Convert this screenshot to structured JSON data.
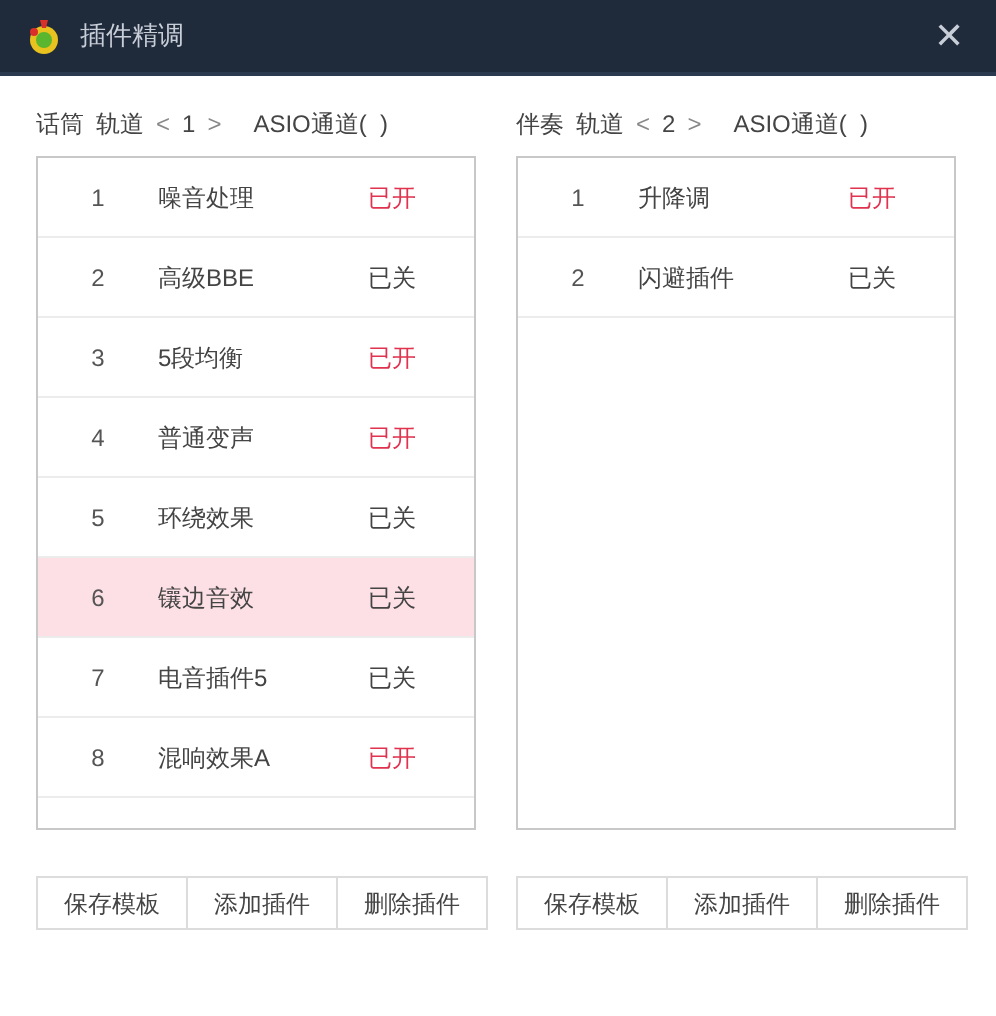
{
  "window": {
    "title": "插件精调",
    "close": "✕"
  },
  "panels": [
    {
      "source": "话筒",
      "track_label": "轨道",
      "track_prev": "<",
      "track": "1",
      "track_next": ">",
      "asio": "ASIO通道(  )",
      "plugins": [
        {
          "index": "1",
          "name": "噪音处理",
          "status": "已开",
          "on": true,
          "selected": false
        },
        {
          "index": "2",
          "name": "高级BBE",
          "status": "已关",
          "on": false,
          "selected": false
        },
        {
          "index": "3",
          "name": "5段均衡",
          "status": "已开",
          "on": true,
          "selected": false
        },
        {
          "index": "4",
          "name": "普通变声",
          "status": "已开",
          "on": true,
          "selected": false
        },
        {
          "index": "5",
          "name": "环绕效果",
          "status": "已关",
          "on": false,
          "selected": false
        },
        {
          "index": "6",
          "name": "镶边音效",
          "status": "已关",
          "on": false,
          "selected": true
        },
        {
          "index": "7",
          "name": "电音插件5",
          "status": "已关",
          "on": false,
          "selected": false
        },
        {
          "index": "8",
          "name": "混响效果A",
          "status": "已开",
          "on": true,
          "selected": false
        }
      ],
      "buttons": [
        "保存模板",
        "添加插件",
        "删除插件"
      ]
    },
    {
      "source": "伴奏",
      "track_label": "轨道",
      "track_prev": "<",
      "track": "2",
      "track_next": ">",
      "asio": "ASIO通道(  )",
      "plugins": [
        {
          "index": "1",
          "name": "升降调",
          "status": "已开",
          "on": true,
          "selected": false
        },
        {
          "index": "2",
          "name": "闪避插件",
          "status": "已关",
          "on": false,
          "selected": false
        }
      ],
      "buttons": [
        "保存模板",
        "添加插件",
        "删除插件"
      ]
    }
  ]
}
